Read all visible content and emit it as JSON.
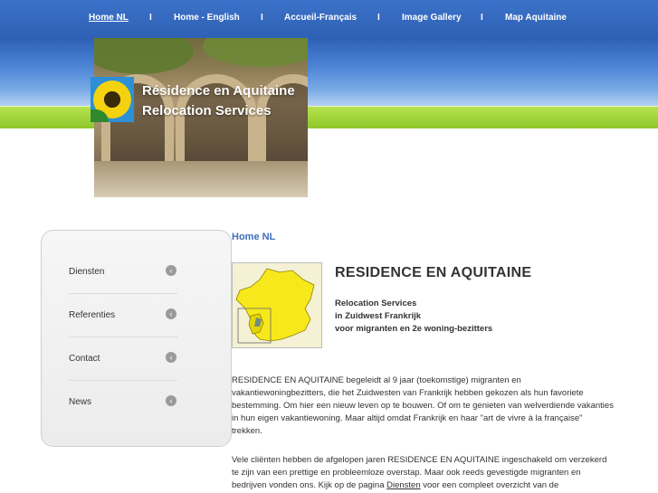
{
  "nav": {
    "items": [
      {
        "label": "Home NL"
      },
      {
        "label": "Home - English"
      },
      {
        "label": "Accueil-Français"
      },
      {
        "label": "Image Gallery"
      },
      {
        "label": "Map Aquitaine"
      }
    ],
    "separator": "I"
  },
  "header": {
    "title_line1": "Résidence en Aquitaine",
    "title_line2": "Relocation Services"
  },
  "sidebar": {
    "items": [
      {
        "label": "Diensten"
      },
      {
        "label": "Referenties"
      },
      {
        "label": "Contact"
      },
      {
        "label": "News"
      }
    ]
  },
  "content": {
    "breadcrumb": "Home NL",
    "title": "RESIDENCE EN AQUITAINE",
    "subtitle1": "Relocation Services",
    "subtitle2": "in Zuidwest Frankrijk",
    "subtitle3": "voor migranten en 2e woning-bezitters",
    "para1_l1": "RESIDENCE EN AQUITAINE begeleidt al 9 jaar (toekomstige) migranten en",
    "para1_l2": "vakantiewoningbezitters, die het Zuidwesten van Frankrijk hebben gekozen als hun favoriete",
    "para1_l3": "bestemming. Om hier een nieuw leven op te bouwen. Of om te genieten van welverdiende vakanties",
    "para1_l4": "in hun eigen vakantiewoning. Maar altijd omdat Frankrijk en haar \"art de vivre à la française\"",
    "para1_l5": "trekken.",
    "para2_l1": "Vele cliënten hebben de afgelopen jaren RESIDENCE EN AQUITAINE ingeschakeld om verzekerd",
    "para2_l2": "te zijn van een prettige en probleemloze overstap. Maar ook reeds gevestigde migranten en",
    "para2_l3a": "bedrijven vonden ons. Kijk op de pagina ",
    "para2_link": "Diensten",
    "para2_l3b": " voor een compleet overzicht van de"
  },
  "colors": {
    "nav_blue": "#2e60b4",
    "green_band": "#8fc72a",
    "link_blue": "#3d6fba",
    "map_yellow": "#f7e81c"
  }
}
